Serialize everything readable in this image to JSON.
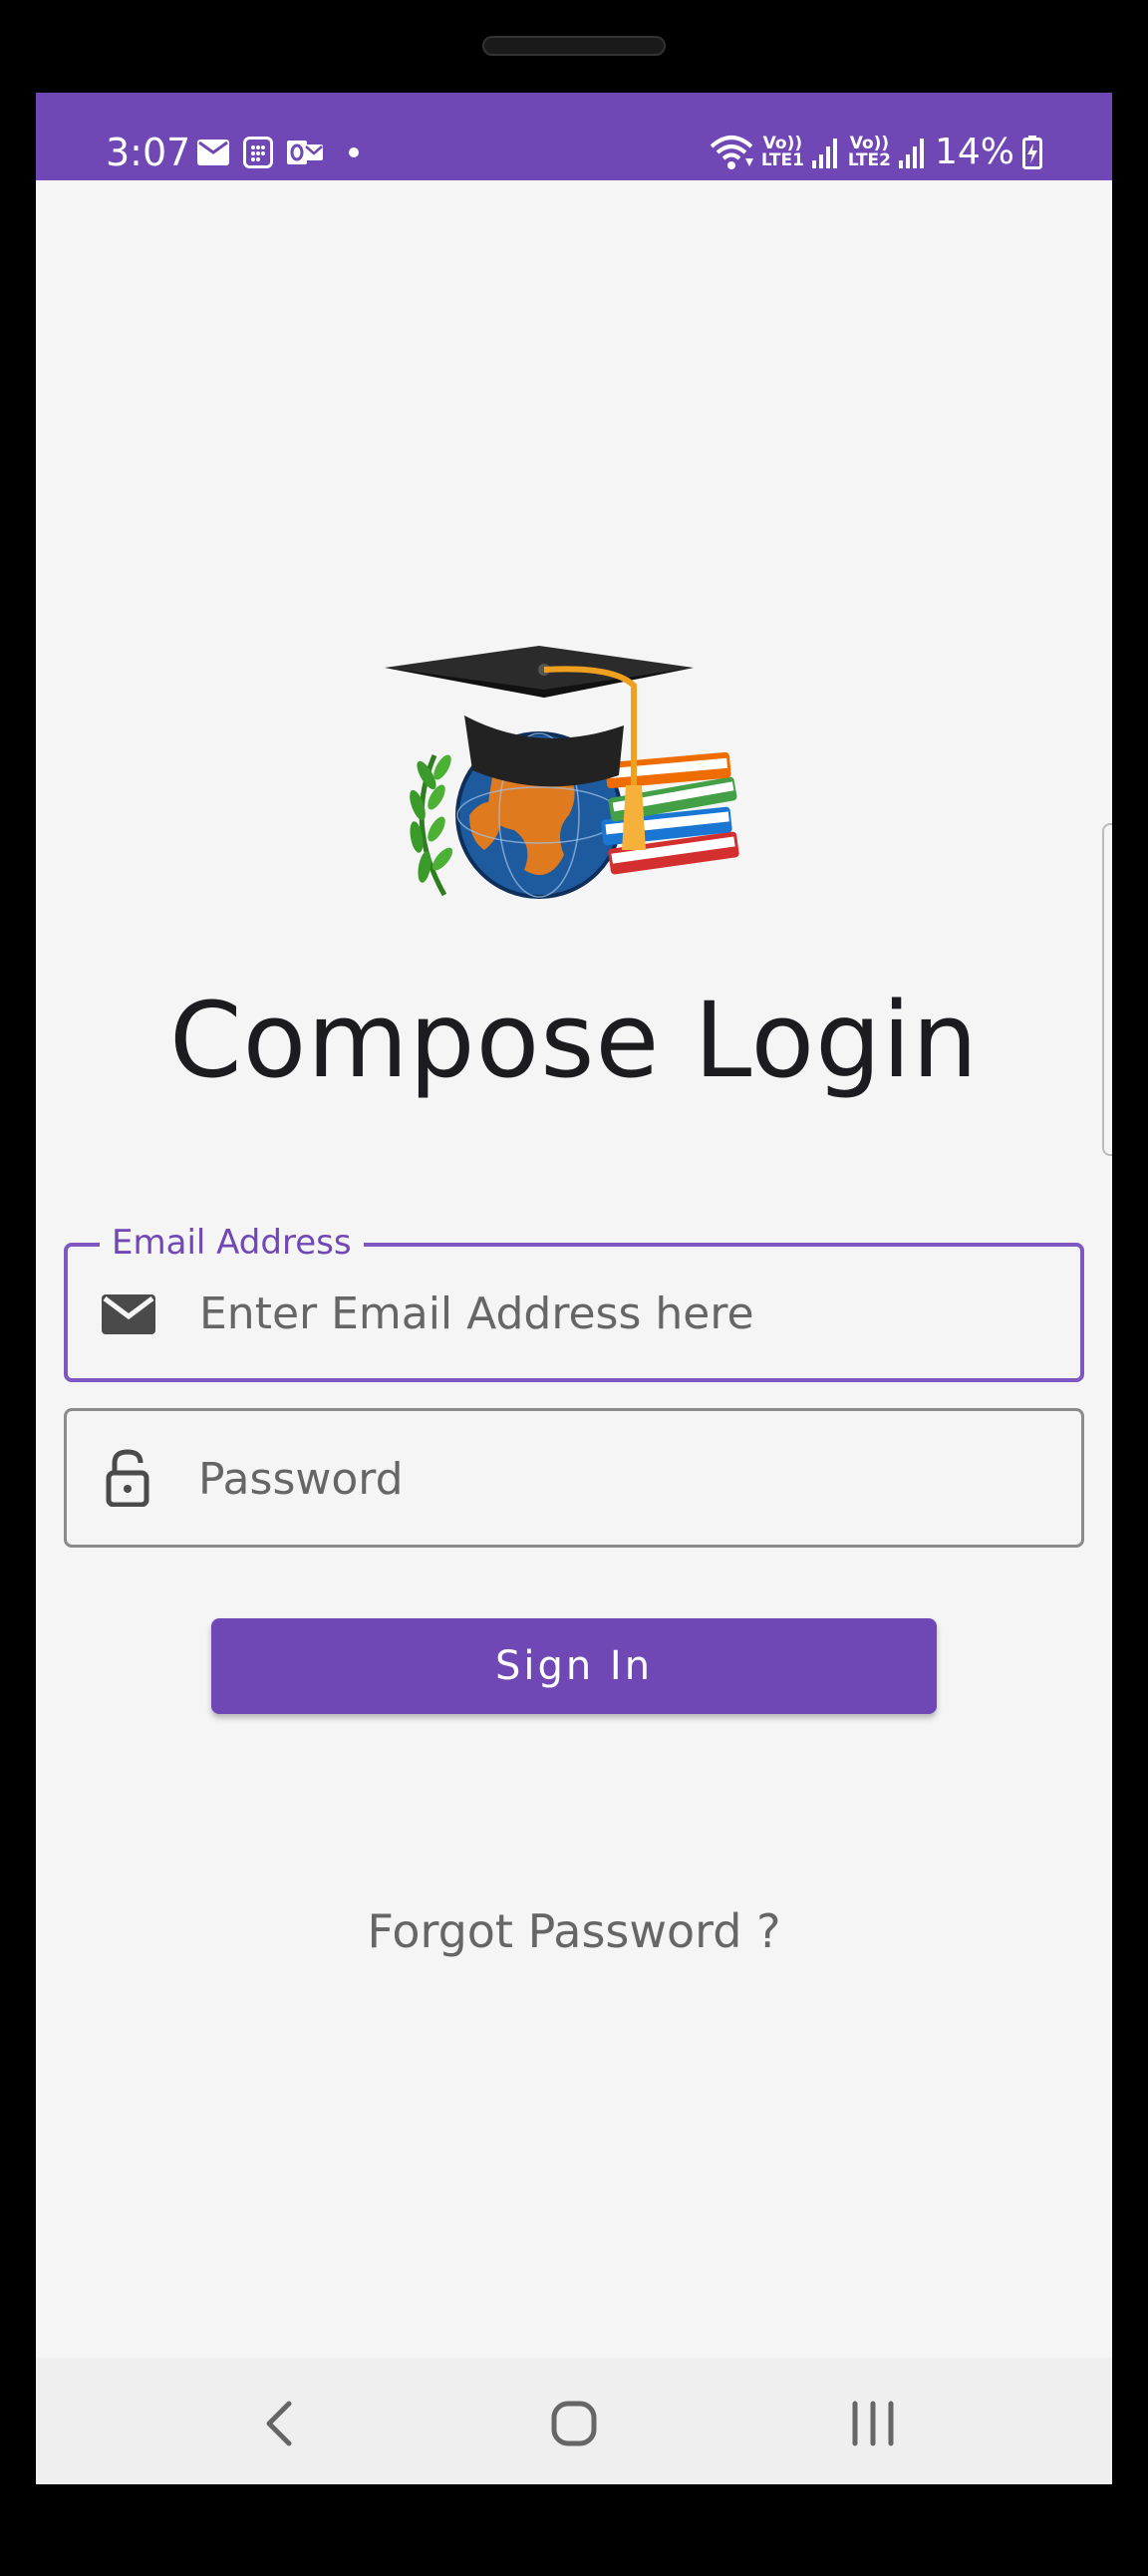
{
  "status_bar": {
    "time": "3:07",
    "left_icons": [
      "mail-icon",
      "sim-card-icon",
      "outlook-icon",
      "dot-icon"
    ],
    "right_icons": [
      "wifi-icon",
      "signal-lte1-icon",
      "signal-lte2-icon",
      "battery-charging-icon"
    ],
    "lte1_label": "Vo))\nLTE1",
    "lte2_label": "Vo))\nLTE2",
    "battery": "14%"
  },
  "app": {
    "logo": "graduation-logo",
    "title": "Compose Login"
  },
  "email_field": {
    "label": "Email Address",
    "placeholder": "Enter Email Address here",
    "value": "",
    "icon": "mail-icon"
  },
  "password_field": {
    "placeholder": "Password",
    "value": "",
    "icon": "lock-open-icon"
  },
  "signin_button": {
    "label": "Sign In"
  },
  "forgot_link": {
    "label": "Forgot Password ?"
  },
  "nav_bar": {
    "buttons": [
      "back-icon",
      "home-icon",
      "recents-icon"
    ]
  },
  "colors": {
    "primary": "#7048b5",
    "focused_outline": "#7e57c2",
    "background": "#f5f5f5",
    "title_text": "#1c1b1f"
  }
}
